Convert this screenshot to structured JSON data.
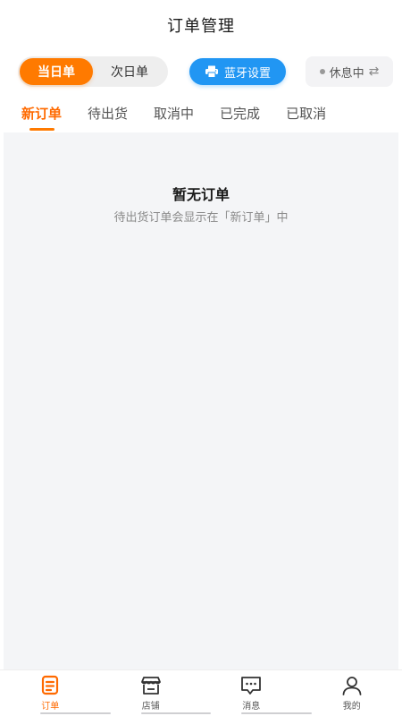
{
  "header": {
    "title": "订单管理"
  },
  "controls": {
    "day_today": "当日单",
    "day_next": "次日单",
    "bluetooth_label": "蓝牙设置",
    "status_label": "休息中"
  },
  "tabs": [
    {
      "label": "新订单",
      "active": true
    },
    {
      "label": "待出货"
    },
    {
      "label": "取消中"
    },
    {
      "label": "已完成"
    },
    {
      "label": "已取消"
    }
  ],
  "empty": {
    "title": "暂无订单",
    "subtitle": "待出货订单会显示在「新订单」中"
  },
  "bottom_nav": [
    {
      "label": "订单",
      "icon": "order-icon",
      "active": true
    },
    {
      "label": "店铺",
      "icon": "store-icon"
    },
    {
      "label": "消息",
      "icon": "message-icon"
    },
    {
      "label": "我的",
      "icon": "user-icon"
    }
  ],
  "colors": {
    "accent": "#ff7a00",
    "bluetooth": "#2196f3",
    "background": "#f4f5f7"
  }
}
